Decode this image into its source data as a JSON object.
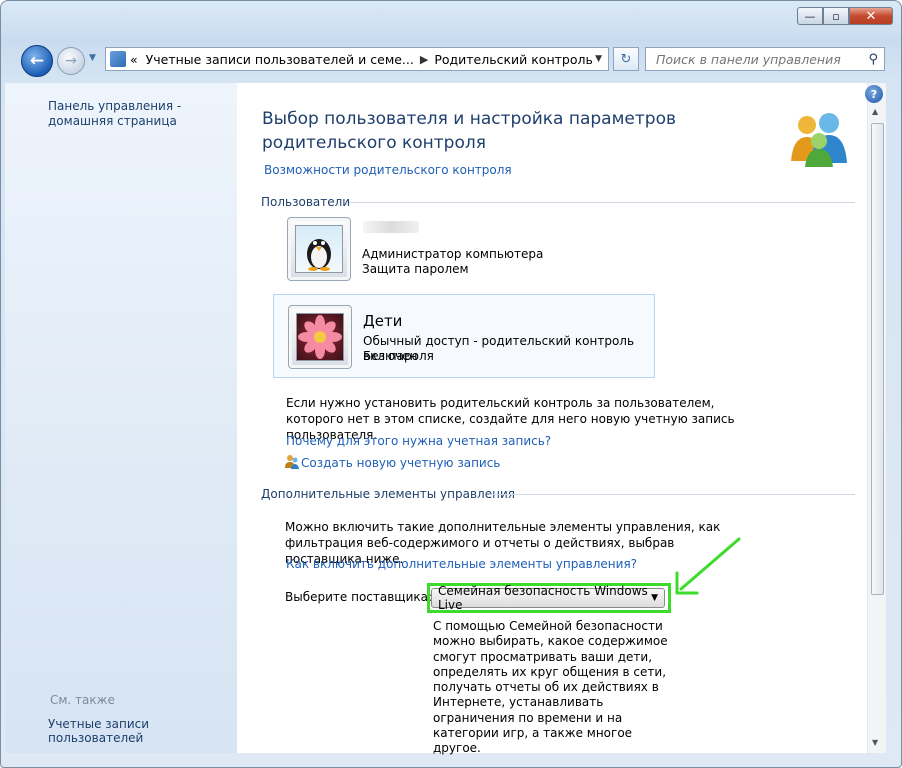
{
  "window": {
    "controls": {
      "minimize": "—",
      "maximize": "▫",
      "close": "✕"
    }
  },
  "nav": {
    "back_glyph": "←",
    "forward_glyph": "→",
    "dropdown_glyph": "▼",
    "breadcrumb": [
      "«",
      "Учетные записи пользователей и семе...",
      "Родительский контроль"
    ],
    "refresh_glyph": "↻",
    "search_placeholder": "Поиск в панели управления"
  },
  "sidebar": {
    "home_link": "Панель управления - домашняя страница",
    "see_also": "См. также",
    "accounts_link": "Учетные записи пользователей"
  },
  "main": {
    "title": "Выбор пользователя и настройка параметров родительского контроля",
    "features_link": "Возможности родительского контроля",
    "users_section": "Пользователи",
    "users": [
      {
        "name": "",
        "line1": "Администратор компьютера",
        "line2": "Защита паролем",
        "picture": "penguin"
      },
      {
        "name": "Дети",
        "line1": "Обычный доступ - родительский контроль включен",
        "line2": "Без пароля",
        "picture": "flower"
      }
    ],
    "info_text": "Если нужно установить родительский контроль за пользователем, которого нет в этом списке, создайте для него новую учетную запись пользователя.",
    "why_link": "Почему для этого нужна учетная запись?",
    "create_link": "Создать новую учетную запись",
    "extra_section": "Дополнительные элементы управления",
    "extra_text": "Можно включить такие дополнительные элементы управления, как фильтрация веб-содержимого и отчеты о действиях, выбрав поставщика ниже.",
    "how_link": "Как включить дополнительные элементы управления?",
    "provider_label": "Выберите поставщика:",
    "provider_value": "Семейная безопасность Windows Live",
    "provider_desc": "С помощью Семейной безопасности можно выбирать, какое содержимое смогут просматривать ваши дети, определять их круг общения в сети, получать отчеты об их действиях в Интернете, устанавливать ограничения по времени и на категории игр, а также многое другое."
  },
  "colors": {
    "link": "#1f5fb7",
    "heading": "#1e3f6d",
    "highlight": "#3ddc2a"
  }
}
